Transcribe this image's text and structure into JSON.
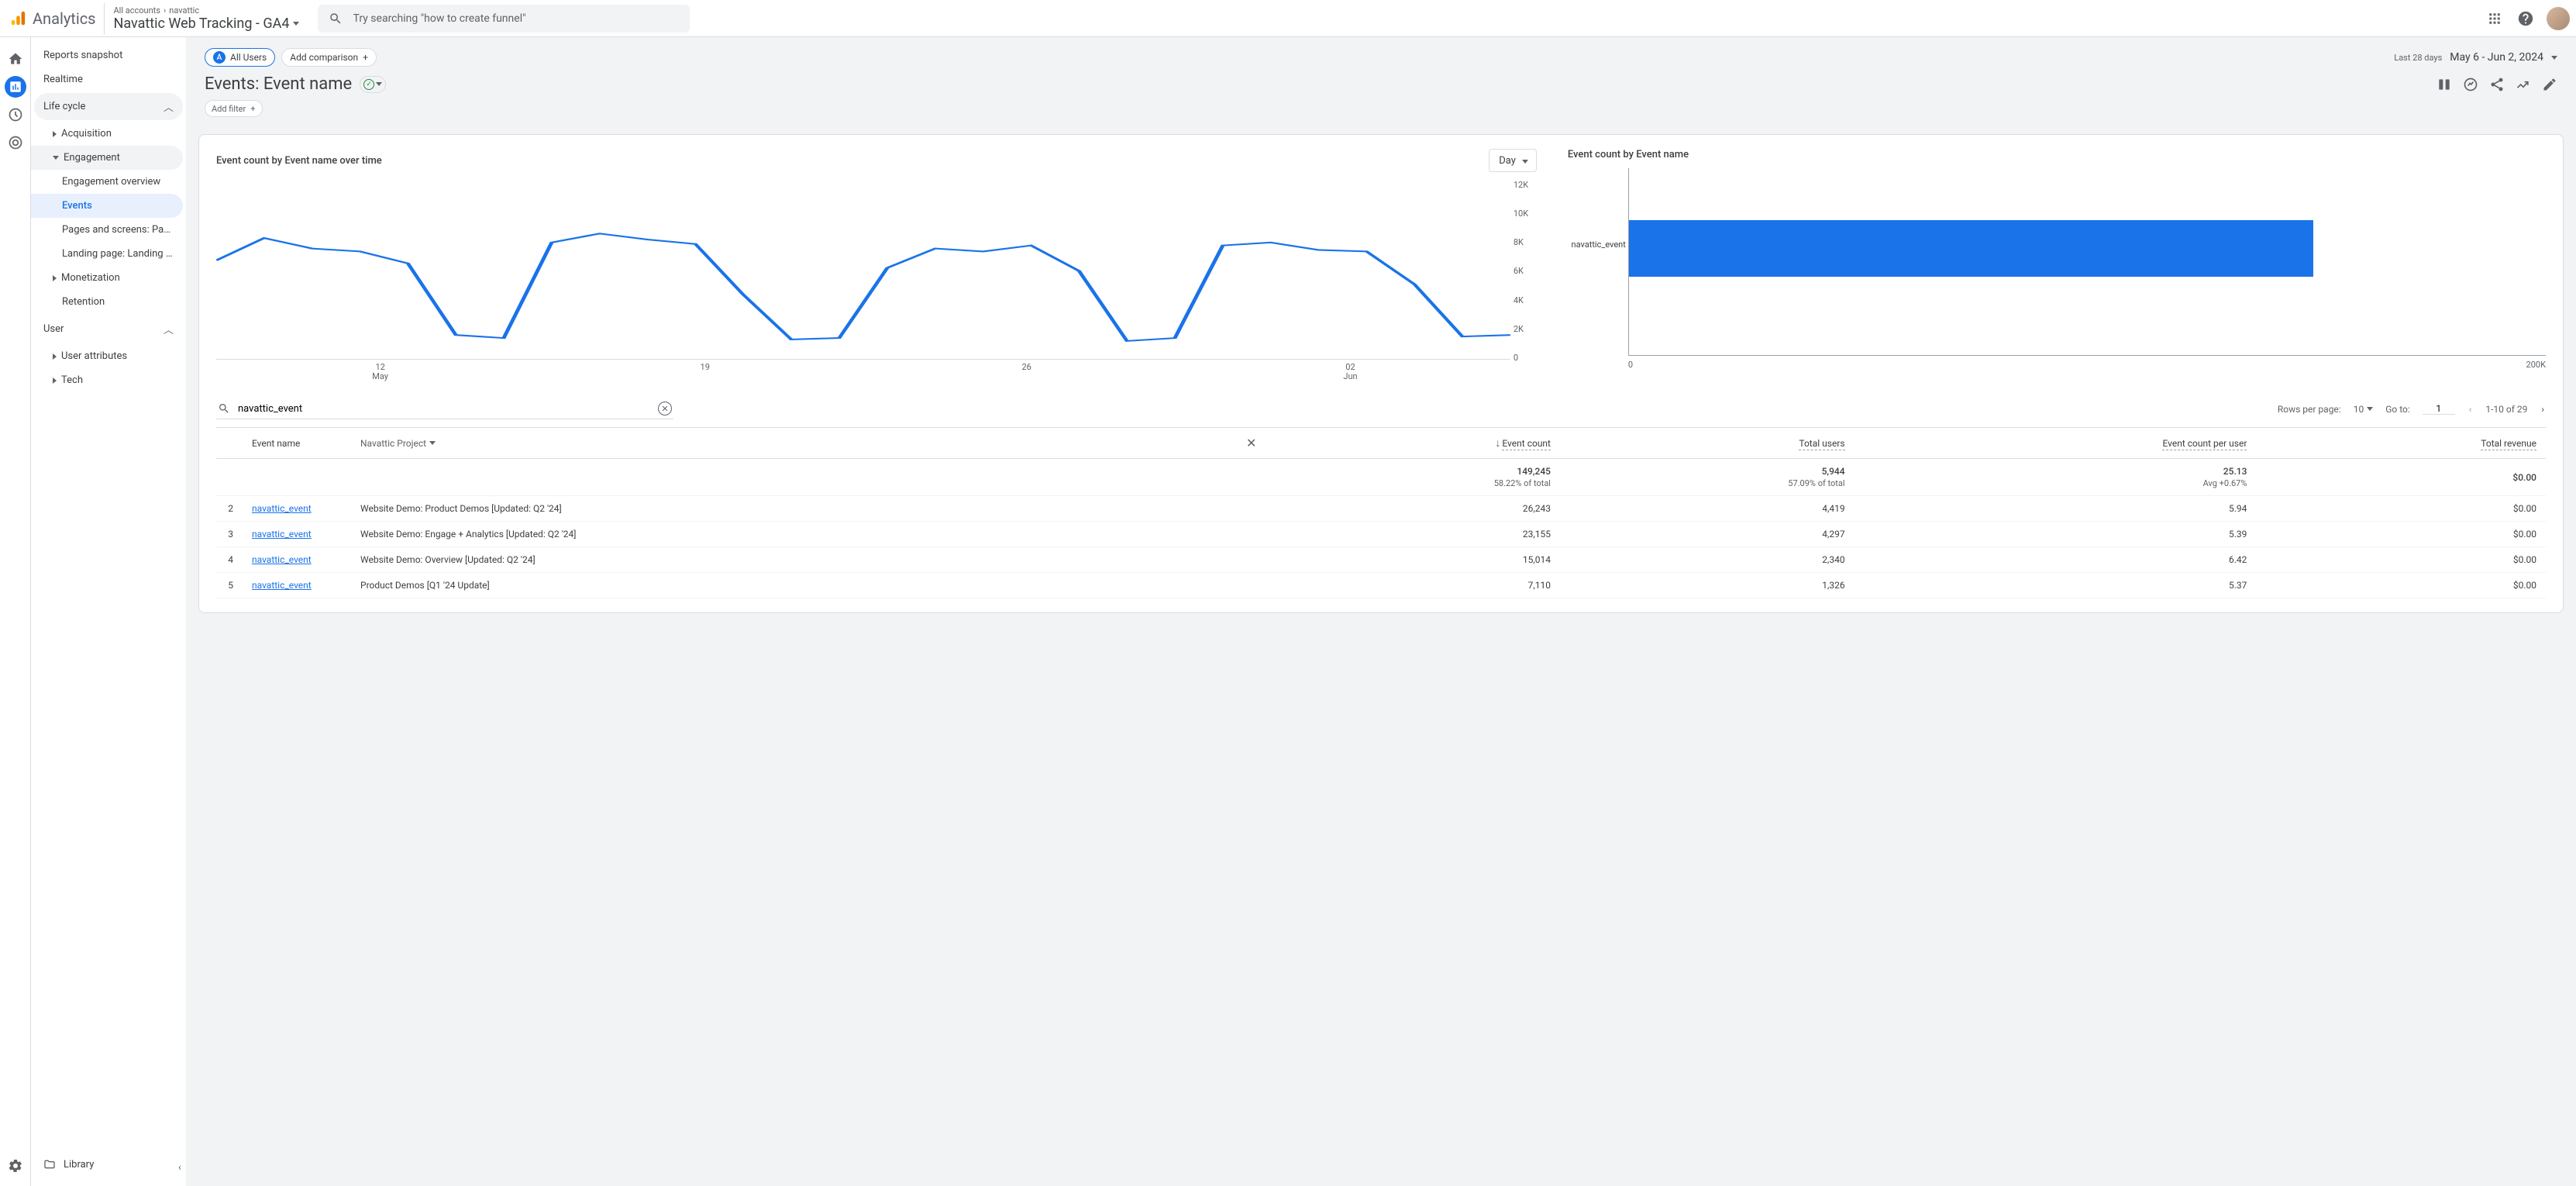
{
  "header": {
    "logo_text": "Analytics",
    "breadcrumb_all": "All accounts",
    "breadcrumb_acct": "navattic",
    "property_name": "Navattic Web Tracking - GA4",
    "search_placeholder": "Try searching \"how to create funnel\""
  },
  "sidenav": {
    "reports_snapshot": "Reports snapshot",
    "realtime": "Realtime",
    "life_cycle": "Life cycle",
    "acquisition": "Acquisition",
    "engagement": "Engagement",
    "engagement_overview": "Engagement overview",
    "events": "Events",
    "pages_screens": "Pages and screens: Page ti...",
    "landing_page": "Landing page: Landing page",
    "monetization": "Monetization",
    "retention": "Retention",
    "user": "User",
    "user_attributes": "User attributes",
    "tech": "Tech",
    "library": "Library"
  },
  "report": {
    "all_users_badge": "A",
    "all_users": "All Users",
    "add_comparison": "Add comparison",
    "date_label": "Last 28 days",
    "date_range": "May 6 - Jun 2, 2024",
    "title": "Events: Event name",
    "add_filter": "Add filter"
  },
  "chart_left": {
    "title": "Event count by Event name over time",
    "granularity": "Day"
  },
  "chart_right": {
    "title": "Event count by Event name",
    "bar_label": "navattic_event"
  },
  "chart_data": [
    {
      "type": "line",
      "title": "Event count by Event name over time",
      "xlabel": "",
      "ylabel": "",
      "ylim": [
        0,
        12000
      ],
      "y_ticks": [
        "12K",
        "10K",
        "8K",
        "6K",
        "4K",
        "2K",
        "0"
      ],
      "x_ticks": [
        {
          "top": "12",
          "bottom": "May"
        },
        {
          "top": "19",
          "bottom": ""
        },
        {
          "top": "26",
          "bottom": ""
        },
        {
          "top": "02",
          "bottom": "Jun"
        }
      ],
      "x": [
        "May 6",
        "May 7",
        "May 8",
        "May 9",
        "May 10",
        "May 11",
        "May 12",
        "May 13",
        "May 14",
        "May 15",
        "May 16",
        "May 17",
        "May 18",
        "May 19",
        "May 20",
        "May 21",
        "May 22",
        "May 23",
        "May 24",
        "May 25",
        "May 26",
        "May 27",
        "May 28",
        "May 29",
        "May 30",
        "May 31",
        "Jun 1",
        "Jun 2"
      ],
      "series": [
        {
          "name": "navattic_event",
          "values": [
            6600,
            8100,
            7400,
            7200,
            6400,
            1600,
            1400,
            7800,
            8400,
            8000,
            7700,
            4300,
            1300,
            1400,
            6100,
            7400,
            7200,
            7600,
            5900,
            1200,
            1400,
            7600,
            7800,
            7300,
            7200,
            5000,
            1500,
            1600
          ]
        }
      ]
    },
    {
      "type": "bar",
      "orientation": "horizontal",
      "title": "Event count by Event name",
      "xlabel": "",
      "ylabel": "",
      "xlim": [
        0,
        200000
      ],
      "x_ticks": [
        "0",
        "200K"
      ],
      "categories": [
        "navattic_event"
      ],
      "values": [
        149245
      ]
    }
  ],
  "table": {
    "search_value": "navattic_event",
    "rows_per_page_label": "Rows per page:",
    "rows_per_page": "10",
    "goto_label": "Go to:",
    "goto_value": "1",
    "range_text": "1-10 of 29",
    "headers": {
      "event_name": "Event name",
      "project_dropdown": "Navattic Project",
      "event_count": "Event count",
      "total_users": "Total users",
      "ec_per_user": "Event count per user",
      "total_revenue": "Total revenue"
    },
    "totals": {
      "event_count": "149,245",
      "event_count_sub": "58.22% of total",
      "total_users": "5,944",
      "total_users_sub": "57.09% of total",
      "ec_per_user": "25.13",
      "ec_per_user_sub": "Avg +0.67%",
      "total_revenue": "$0.00"
    },
    "rows": [
      {
        "idx": "2",
        "event": "navattic_event",
        "project": "Website Demo: Product Demos [Updated: Q2 '24]",
        "event_count": "26,243",
        "total_users": "4,419",
        "ec_per_user": "5.94",
        "total_revenue": "$0.00"
      },
      {
        "idx": "3",
        "event": "navattic_event",
        "project": "Website Demo: Engage + Analytics [Updated: Q2 '24]",
        "event_count": "23,155",
        "total_users": "4,297",
        "ec_per_user": "5.39",
        "total_revenue": "$0.00"
      },
      {
        "idx": "4",
        "event": "navattic_event",
        "project": "Website Demo: Overview [Updated: Q2 '24]",
        "event_count": "15,014",
        "total_users": "2,340",
        "ec_per_user": "6.42",
        "total_revenue": "$0.00"
      },
      {
        "idx": "5",
        "event": "navattic_event",
        "project": "Product Demos [Q1 '24 Update]",
        "event_count": "7,110",
        "total_users": "1,326",
        "ec_per_user": "5.37",
        "total_revenue": "$0.00"
      }
    ]
  }
}
